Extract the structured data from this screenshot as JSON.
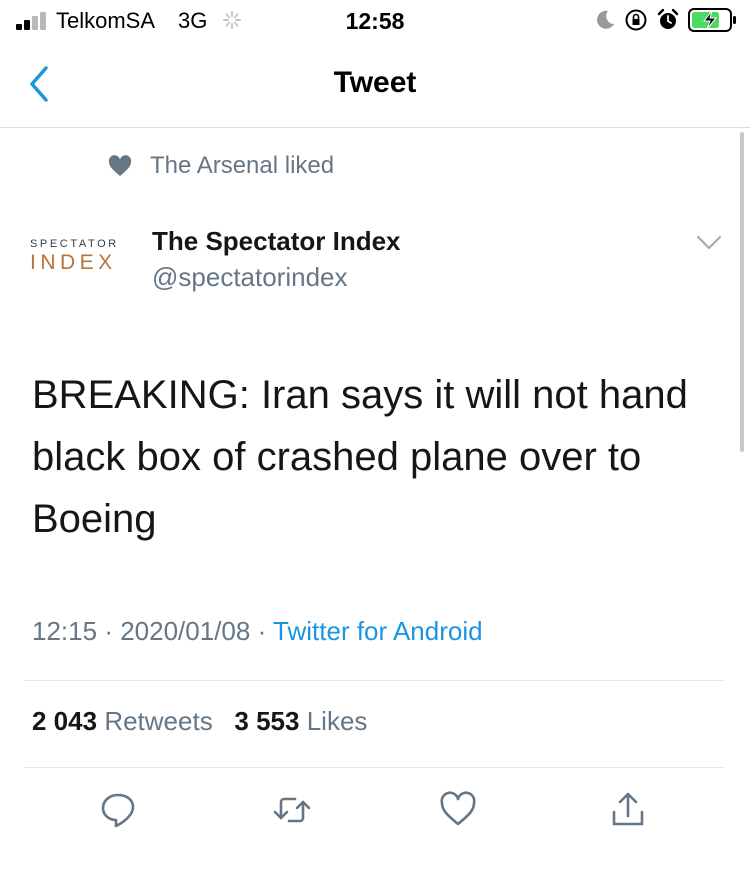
{
  "status_bar": {
    "carrier": "TelkomSA",
    "network": "3G",
    "time": "12:58"
  },
  "nav": {
    "title": "Tweet"
  },
  "tweet": {
    "social_context": "The Arsenal liked",
    "author": {
      "name": "The Spectator Index",
      "handle": "@spectatorindex",
      "avatar_line1": "SPECTATOR",
      "avatar_line2": "INDEX"
    },
    "text": "BREAKING: Iran says it will not hand black box of crashed plane over to Boeing",
    "time": "12:15",
    "date": "2020/01/08",
    "separator": "·",
    "source": "Twitter for Android",
    "stats": {
      "retweets_count": "2 043",
      "retweets_label": "Retweets",
      "likes_count": "3 553",
      "likes_label": "Likes"
    }
  },
  "colors": {
    "accent": "#1b95e0",
    "secondary_text": "#657786",
    "primary_text": "#14171a",
    "divider": "#e1e8ed",
    "battery_green": "#4cd964",
    "avatar_orange": "#b8733a"
  },
  "icons": {
    "back": "chevron-left-icon",
    "liked": "heart-icon",
    "caret": "chevron-down-icon",
    "reply": "comment-icon",
    "retweet": "retweet-icon",
    "like": "heart-outline-icon",
    "share": "share-icon"
  }
}
